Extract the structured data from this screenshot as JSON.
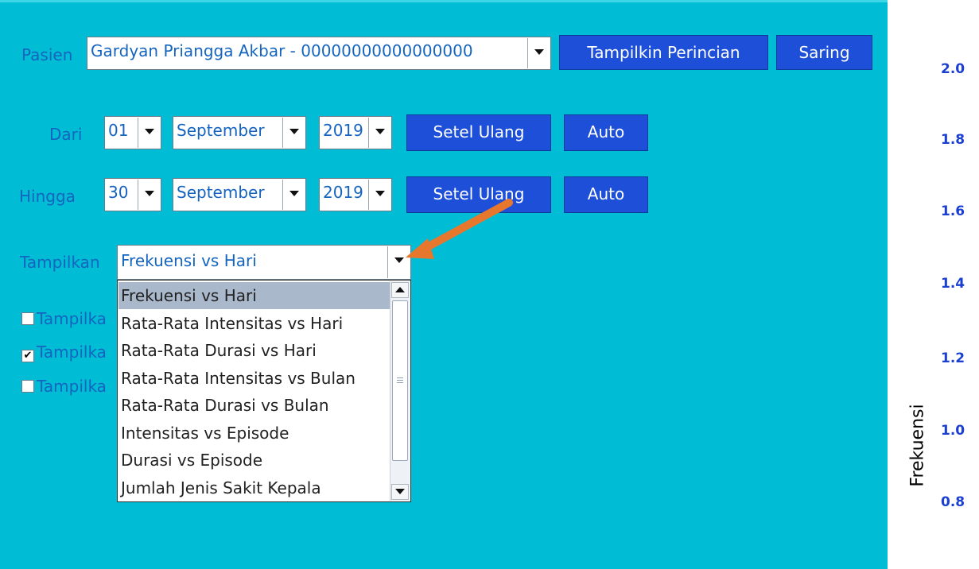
{
  "form": {
    "patient_label": "Pasien",
    "patient_value": "Gardyan Priangga Akbar - 00000000000000000",
    "details_button": "Tampilkin Perincian",
    "filter_button": "Saring",
    "from_label": "Dari",
    "from_day": "01",
    "from_month": "September",
    "from_year": "2019",
    "to_label": "Hingga",
    "to_day": "30",
    "to_month": "September",
    "to_year": "2019",
    "reset_button": "Setel Ulang",
    "auto_button": "Auto",
    "display_label": "Tampilkan",
    "display_value": "Frekuensi vs Hari",
    "checkbox_label": "Tampilka",
    "checkboxes": [
      {
        "checked": false,
        "mark": ""
      },
      {
        "checked": true,
        "mark": "✔"
      },
      {
        "checked": false,
        "mark": ""
      }
    ]
  },
  "dropdown": {
    "selected_index": 0,
    "options": [
      "Frekuensi vs Hari",
      "Rata-Rata Intensitas vs Hari",
      "Rata-Rata Durasi vs Hari",
      "Rata-Rata Intensitas vs Bulan",
      "Rata-Rata Durasi vs Bulan",
      "Intensitas vs Episode",
      "Durasi vs Episode",
      "Jumlah Jenis Sakit Kepala"
    ]
  },
  "chart_axis": {
    "ylabel": "Frekuensi",
    "ticks": [
      "2.0",
      "1.8",
      "1.6",
      "1.4",
      "1.2",
      "1.0",
      "0.8"
    ]
  },
  "colors": {
    "panel_bg": "#00BCD4",
    "button_bg": "#1E4FD8",
    "label_text": "#1565C0",
    "annotation_arrow": "#E8772E",
    "tick_text": "#1A3FD1"
  }
}
